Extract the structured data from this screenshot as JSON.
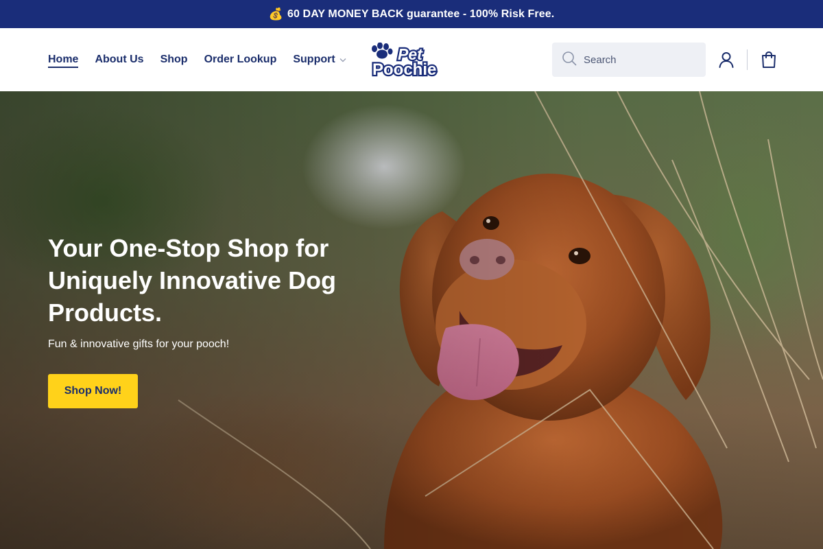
{
  "announcement": {
    "icon": "money-bag-icon",
    "text": "60 DAY MONEY BACK guarantee - 100% Risk Free."
  },
  "nav": {
    "items": [
      {
        "label": "Home",
        "active": true
      },
      {
        "label": "About Us"
      },
      {
        "label": "Shop"
      },
      {
        "label": "Order Lookup"
      },
      {
        "label": "Support",
        "has_dropdown": true
      }
    ]
  },
  "logo": {
    "line1": "Pet",
    "line2": "Poochie",
    "icon": "paw-print-icon"
  },
  "search": {
    "placeholder": "Search",
    "icon": "search-icon"
  },
  "header_icons": {
    "account": "user-icon",
    "cart": "shopping-bag-icon"
  },
  "hero": {
    "title": "Your One-Stop Shop for Uniquely Innovative Dog Products.",
    "subtitle": "Fun & innovative gifts for your pooch!",
    "cta_label": "Shop Now!"
  },
  "colors": {
    "brand_navy": "#1a2d7a",
    "text_navy": "#1a2d6b",
    "cta_yellow": "#ffd21a",
    "search_bg": "#eef0f5"
  }
}
